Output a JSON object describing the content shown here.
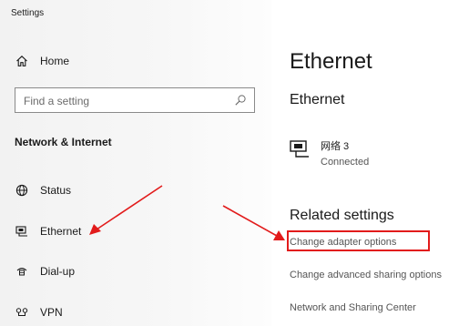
{
  "window": {
    "title": "Settings"
  },
  "sidebar": {
    "home_label": "Home",
    "search_placeholder": "Find a setting",
    "section_header": "Network & Internet",
    "items": [
      {
        "label": "Status",
        "icon": "globe-icon"
      },
      {
        "label": "Ethernet",
        "icon": "ethernet-icon"
      },
      {
        "label": "Dial-up",
        "icon": "dialup-icon"
      },
      {
        "label": "VPN",
        "icon": "vpn-icon"
      }
    ]
  },
  "main": {
    "title": "Ethernet",
    "subheading": "Ethernet",
    "adapter": {
      "name": "网络 3",
      "status": "Connected",
      "icon": "ethernet-adapter-icon"
    },
    "related_title": "Related settings",
    "links": [
      {
        "label": "Change adapter options"
      },
      {
        "label": "Change advanced sharing options"
      },
      {
        "label": "Network and Sharing Center"
      }
    ]
  },
  "annotations": {
    "color": "#e21b1b"
  }
}
